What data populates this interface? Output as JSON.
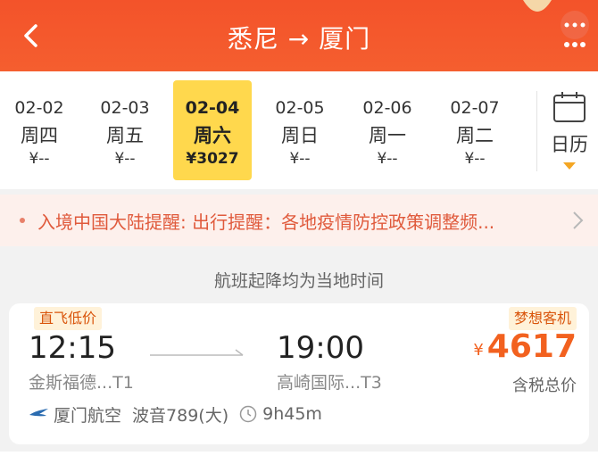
{
  "header": {
    "title": "悉尼 → 厦门",
    "back_icon": "chevron-left-icon",
    "more_icon": "more-dots-icon",
    "background": "#f3532a"
  },
  "dates": [
    {
      "date": "02-02",
      "weekday": "周四",
      "price": "¥--"
    },
    {
      "date": "02-03",
      "weekday": "周五",
      "price": "¥--"
    },
    {
      "date": "02-04",
      "weekday": "周六",
      "price": "¥3027",
      "selected": true
    },
    {
      "date": "02-05",
      "weekday": "周日",
      "price": "¥--"
    },
    {
      "date": "02-06",
      "weekday": "周一",
      "price": "¥--"
    },
    {
      "date": "02-07",
      "weekday": "周二",
      "price": "¥--"
    }
  ],
  "calendar": {
    "label": "日历",
    "icon": "calendar-icon"
  },
  "notice": {
    "text": "入境中国大陆提醒: 出行提醒：各地疫情防控政策调整频..."
  },
  "timezone_note": "航班起降均为当地时间",
  "flight": {
    "tag_left": "直飞低价",
    "tag_right": "梦想客机",
    "departure_time": "12:15",
    "arrival_time": "19:00",
    "departure_airport": "金斯福德...T1",
    "arrival_airport": "高崎国际...T3",
    "price_currency": "¥",
    "price": "4617",
    "price_note": "含税总价",
    "airline": "厦门航空",
    "aircraft": "波音789(大)",
    "duration": "9h45m"
  },
  "colors": {
    "accent": "#f2611f",
    "selected_date": "#ffd84d",
    "notice_text": "#e05a3c"
  }
}
